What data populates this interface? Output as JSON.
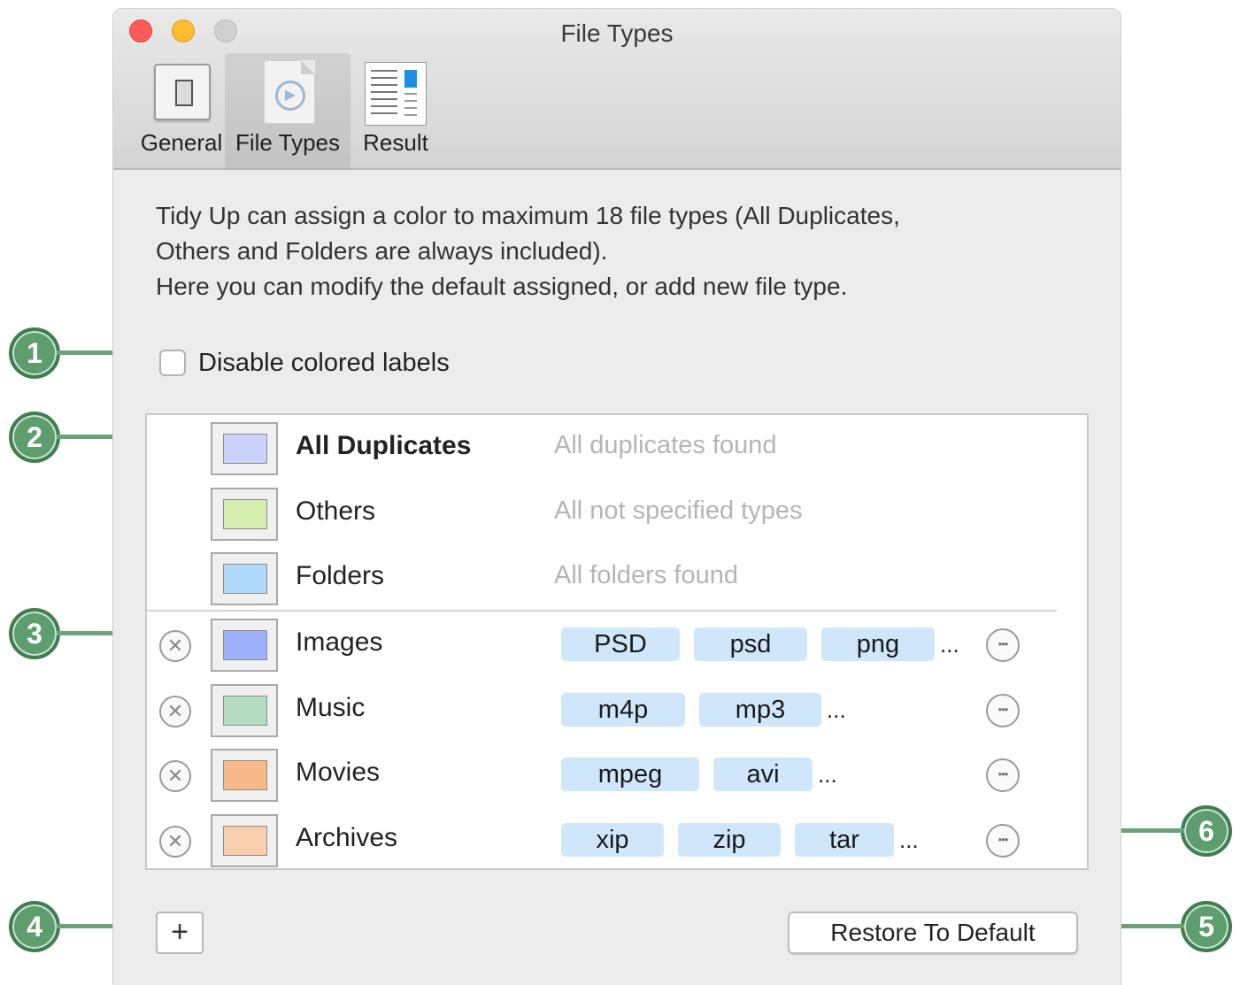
{
  "window": {
    "title": "File Types"
  },
  "toolbar": {
    "items": [
      {
        "label": "General",
        "icon": "general-icon"
      },
      {
        "label": "File Types",
        "icon": "file-types-icon",
        "selected": true
      },
      {
        "label": "Result",
        "icon": "result-icon"
      }
    ]
  },
  "description": {
    "line1": "Tidy Up can assign a color to maximum 18 file types (All Duplicates,",
    "line2": "Others and Folders are always included).",
    "line3": "Here you can modify the default assigned, or add new file type."
  },
  "disable_labels": {
    "label": "Disable colored labels",
    "checked": false
  },
  "fixed_types": [
    {
      "name": "All Duplicates",
      "description": "All duplicates found",
      "color": "#cbd3fb"
    },
    {
      "name": "Others",
      "description": "All not specified types",
      "color": "#d5eeb0"
    },
    {
      "name": "Folders",
      "description": "All folders found",
      "color": "#aed8f9"
    }
  ],
  "custom_types": [
    {
      "name": "Images",
      "color": "#9cb1f7",
      "tags": [
        "PSD",
        "psd",
        "png"
      ],
      "more": "..."
    },
    {
      "name": "Music",
      "color": "#b3dcc0",
      "tags": [
        "m4p",
        "mp3"
      ],
      "more": "..."
    },
    {
      "name": "Movies",
      "color": "#f7b98a",
      "tags": [
        "mpeg",
        "avi"
      ],
      "more": "..."
    },
    {
      "name": "Archives",
      "color": "#f9d0ad",
      "tags": [
        "xip",
        "zip",
        "tar"
      ],
      "more": "..."
    }
  ],
  "buttons": {
    "add": "+",
    "restore": "Restore To Default"
  },
  "callouts": [
    "1",
    "2",
    "3",
    "4",
    "5",
    "6"
  ],
  "colors": {
    "callout": "#5e9e6e",
    "tag": "#cfe6fb"
  }
}
